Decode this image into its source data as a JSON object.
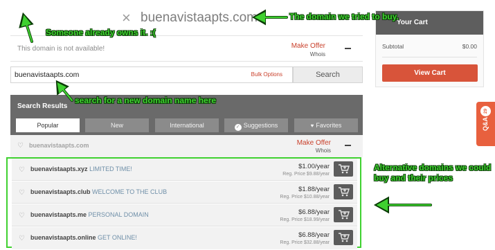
{
  "header": {
    "close_glyph": "×",
    "domain": "buenavistaapts.com"
  },
  "unavailable": {
    "message": "This domain is not available!",
    "make_offer": "Make Offer",
    "whois": "Whois"
  },
  "search": {
    "value": "buenavistaapts.com",
    "bulk_options": "Bulk Options",
    "button": "Search"
  },
  "results": {
    "title": "Search Results",
    "tabs": [
      {
        "label": "Popular",
        "icon": ""
      },
      {
        "label": "New",
        "icon": ""
      },
      {
        "label": "International",
        "icon": ""
      },
      {
        "label": "Suggestions",
        "icon": "check-circle-icon"
      },
      {
        "label": "Favorites",
        "icon": "heart-icon"
      }
    ],
    "taken": {
      "domain": "buenavistaapts.com",
      "make_offer": "Make Offer",
      "whois": "Whois"
    },
    "alternatives": [
      {
        "domain": "buenavistaapts.xyz",
        "tagline": "LIMITED TIME!",
        "price": "$1.00/year",
        "reg_price": "Reg. Price $9.88/year"
      },
      {
        "domain": "buenavistaapts.club",
        "tagline": "WELCOME TO THE CLUB",
        "price": "$1.88/year",
        "reg_price": "Reg. Price $10.88/year"
      },
      {
        "domain": "buenavistaapts.me",
        "tagline": "PERSONAL DOMAIN",
        "price": "$6.88/year",
        "reg_price": "Reg. Price $18.99/year"
      },
      {
        "domain": "buenavistaapts.online",
        "tagline": "GET ONLINE!",
        "price": "$6.88/year",
        "reg_price": "Reg. Price $32.88/year"
      }
    ]
  },
  "cart": {
    "title": "Your Cart",
    "subtotal_label": "Subtotal",
    "subtotal_value": "$0.00",
    "view_cart": "View Cart"
  },
  "qa_tab": {
    "label": "Q&A",
    "count": "29"
  },
  "annotations": {
    "domain_note": "The domain we tried to buy.",
    "owned_note": "Someone already owns it. :(",
    "search_note": "search for a new domain name here",
    "alt_note": "Alternative domains we could buy and their prices"
  },
  "colors": {
    "annotation": "#3fd130",
    "accent": "#d8543a",
    "panel": "#6a6a6a"
  }
}
